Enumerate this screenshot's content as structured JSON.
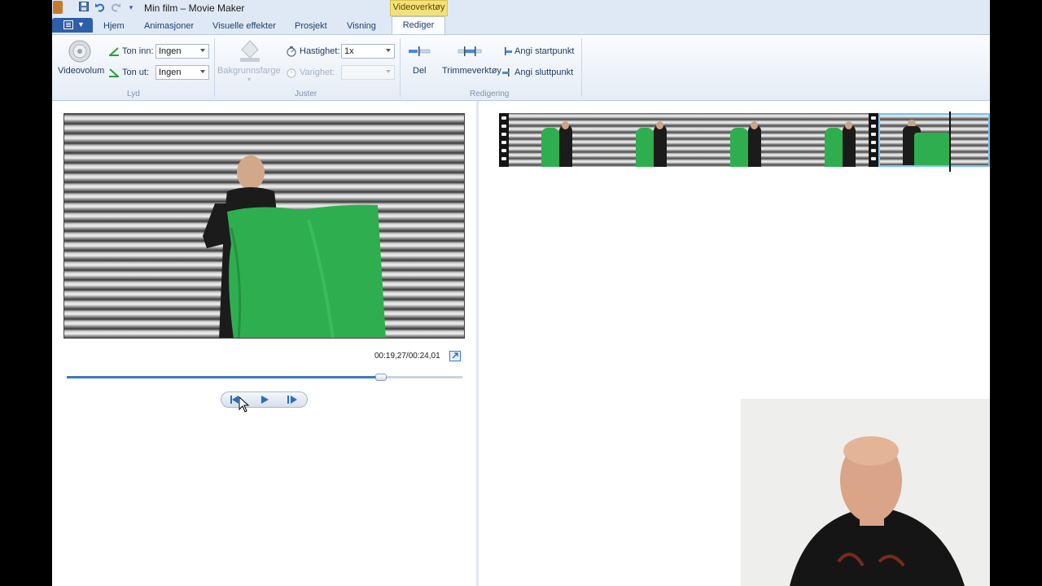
{
  "window": {
    "title": "Min film – Movie Maker",
    "context_tab": "Videoverktøy"
  },
  "tabs": {
    "hjem": "Hjem",
    "animasjoner": "Animasjoner",
    "visuelle": "Visuelle effekter",
    "prosjekt": "Prosjekt",
    "visning": "Visning",
    "rediger": "Rediger",
    "active": "Rediger"
  },
  "ribbon": {
    "lyd": {
      "label": "Lyd",
      "videovolum": "Videovolum",
      "ton_inn_label": "Ton inn:",
      "ton_inn_value": "Ingen",
      "ton_ut_label": "Ton ut:",
      "ton_ut_value": "Ingen"
    },
    "juster": {
      "label": "Juster",
      "bakgrunnsfarge": "Bakgrunnsfarge",
      "hastighet_label": "Hastighet:",
      "hastighet_value": "1x",
      "varighet_label": "Varighet:",
      "varighet_value": ""
    },
    "redigering": {
      "label": "Redigering",
      "del": "Del",
      "trimmeverktoy": "Trimmeverktøy",
      "angi_startpunkt": "Angi startpunkt",
      "angi_sluttpunkt": "Angi sluttpunkt"
    }
  },
  "player": {
    "time": "00:19,27/00:24,01",
    "progress": 0.795
  },
  "colors": {
    "accent": "#3b79c4",
    "context_tab": "#f3e27a",
    "greenscreen": "#2fae4f",
    "selection": "#78c3f0"
  }
}
